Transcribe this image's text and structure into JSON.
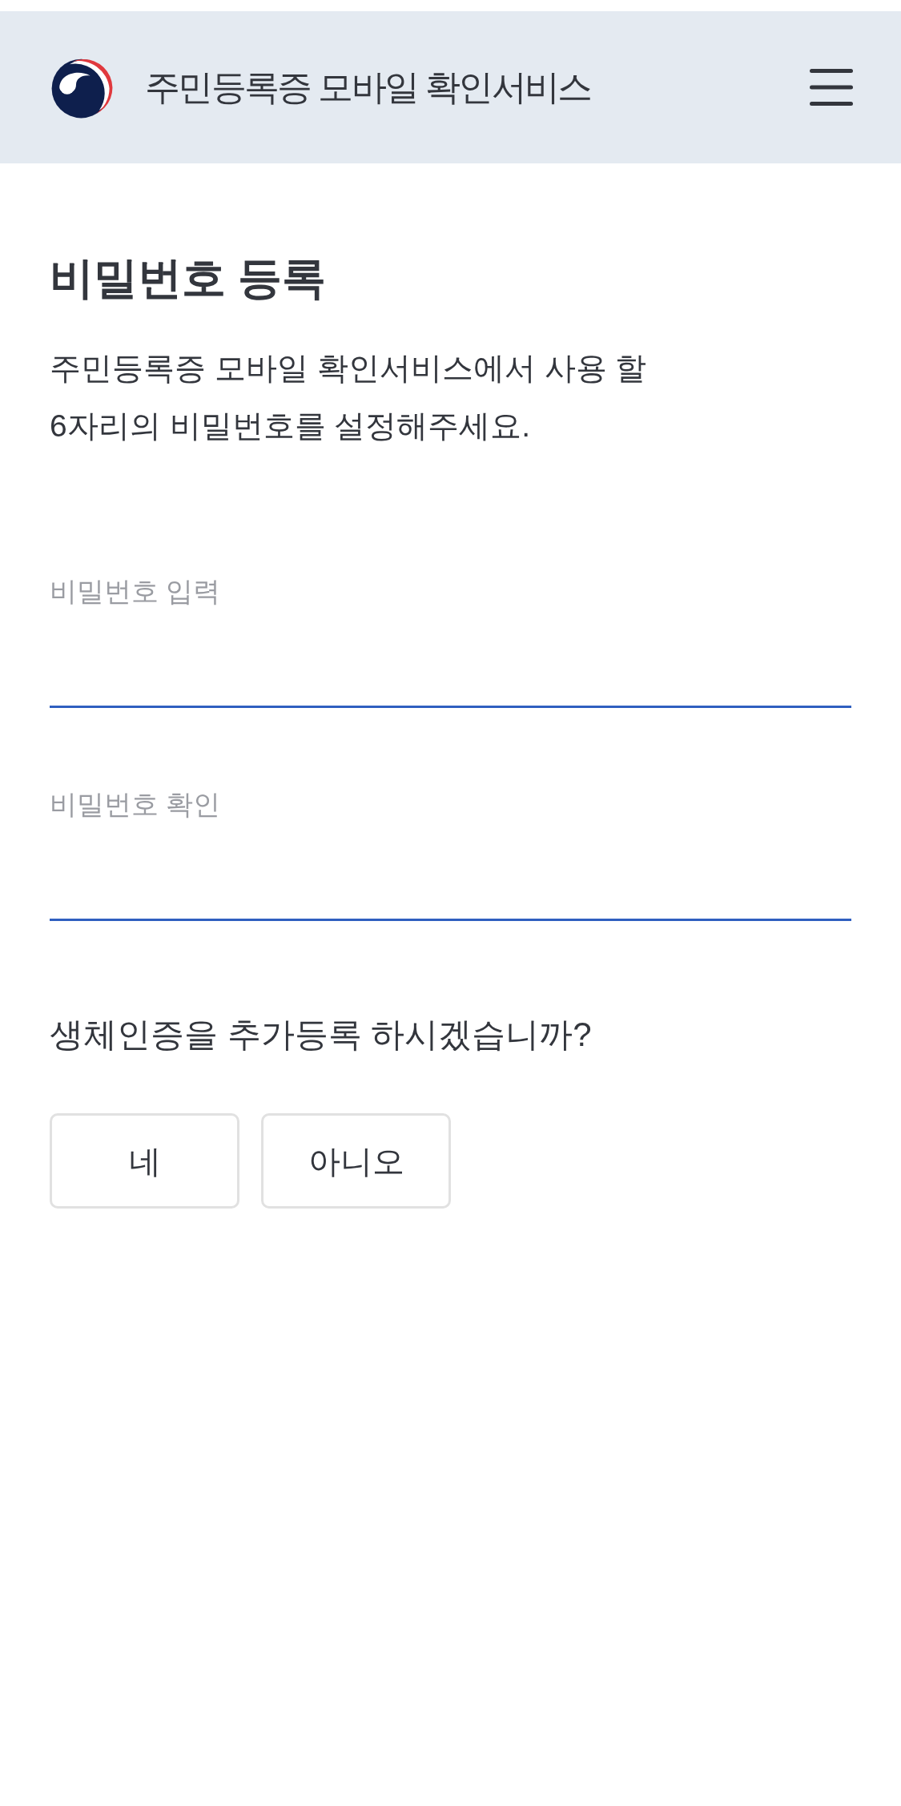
{
  "header": {
    "title": "주민등록증 모바일 확인서비스"
  },
  "page": {
    "heading": "비밀번호 등록",
    "description": "주민등록증 모바일 확인서비스에서 사용 할\n6자리의 비밀번호를 설정해주세요."
  },
  "fields": [
    {
      "label": "비밀번호 입력"
    },
    {
      "label": "비밀번호 확인"
    }
  ],
  "question": "생체인증을 추가등록 하시겠습니까?",
  "buttons": [
    {
      "label": "네"
    },
    {
      "label": "아니오"
    }
  ]
}
